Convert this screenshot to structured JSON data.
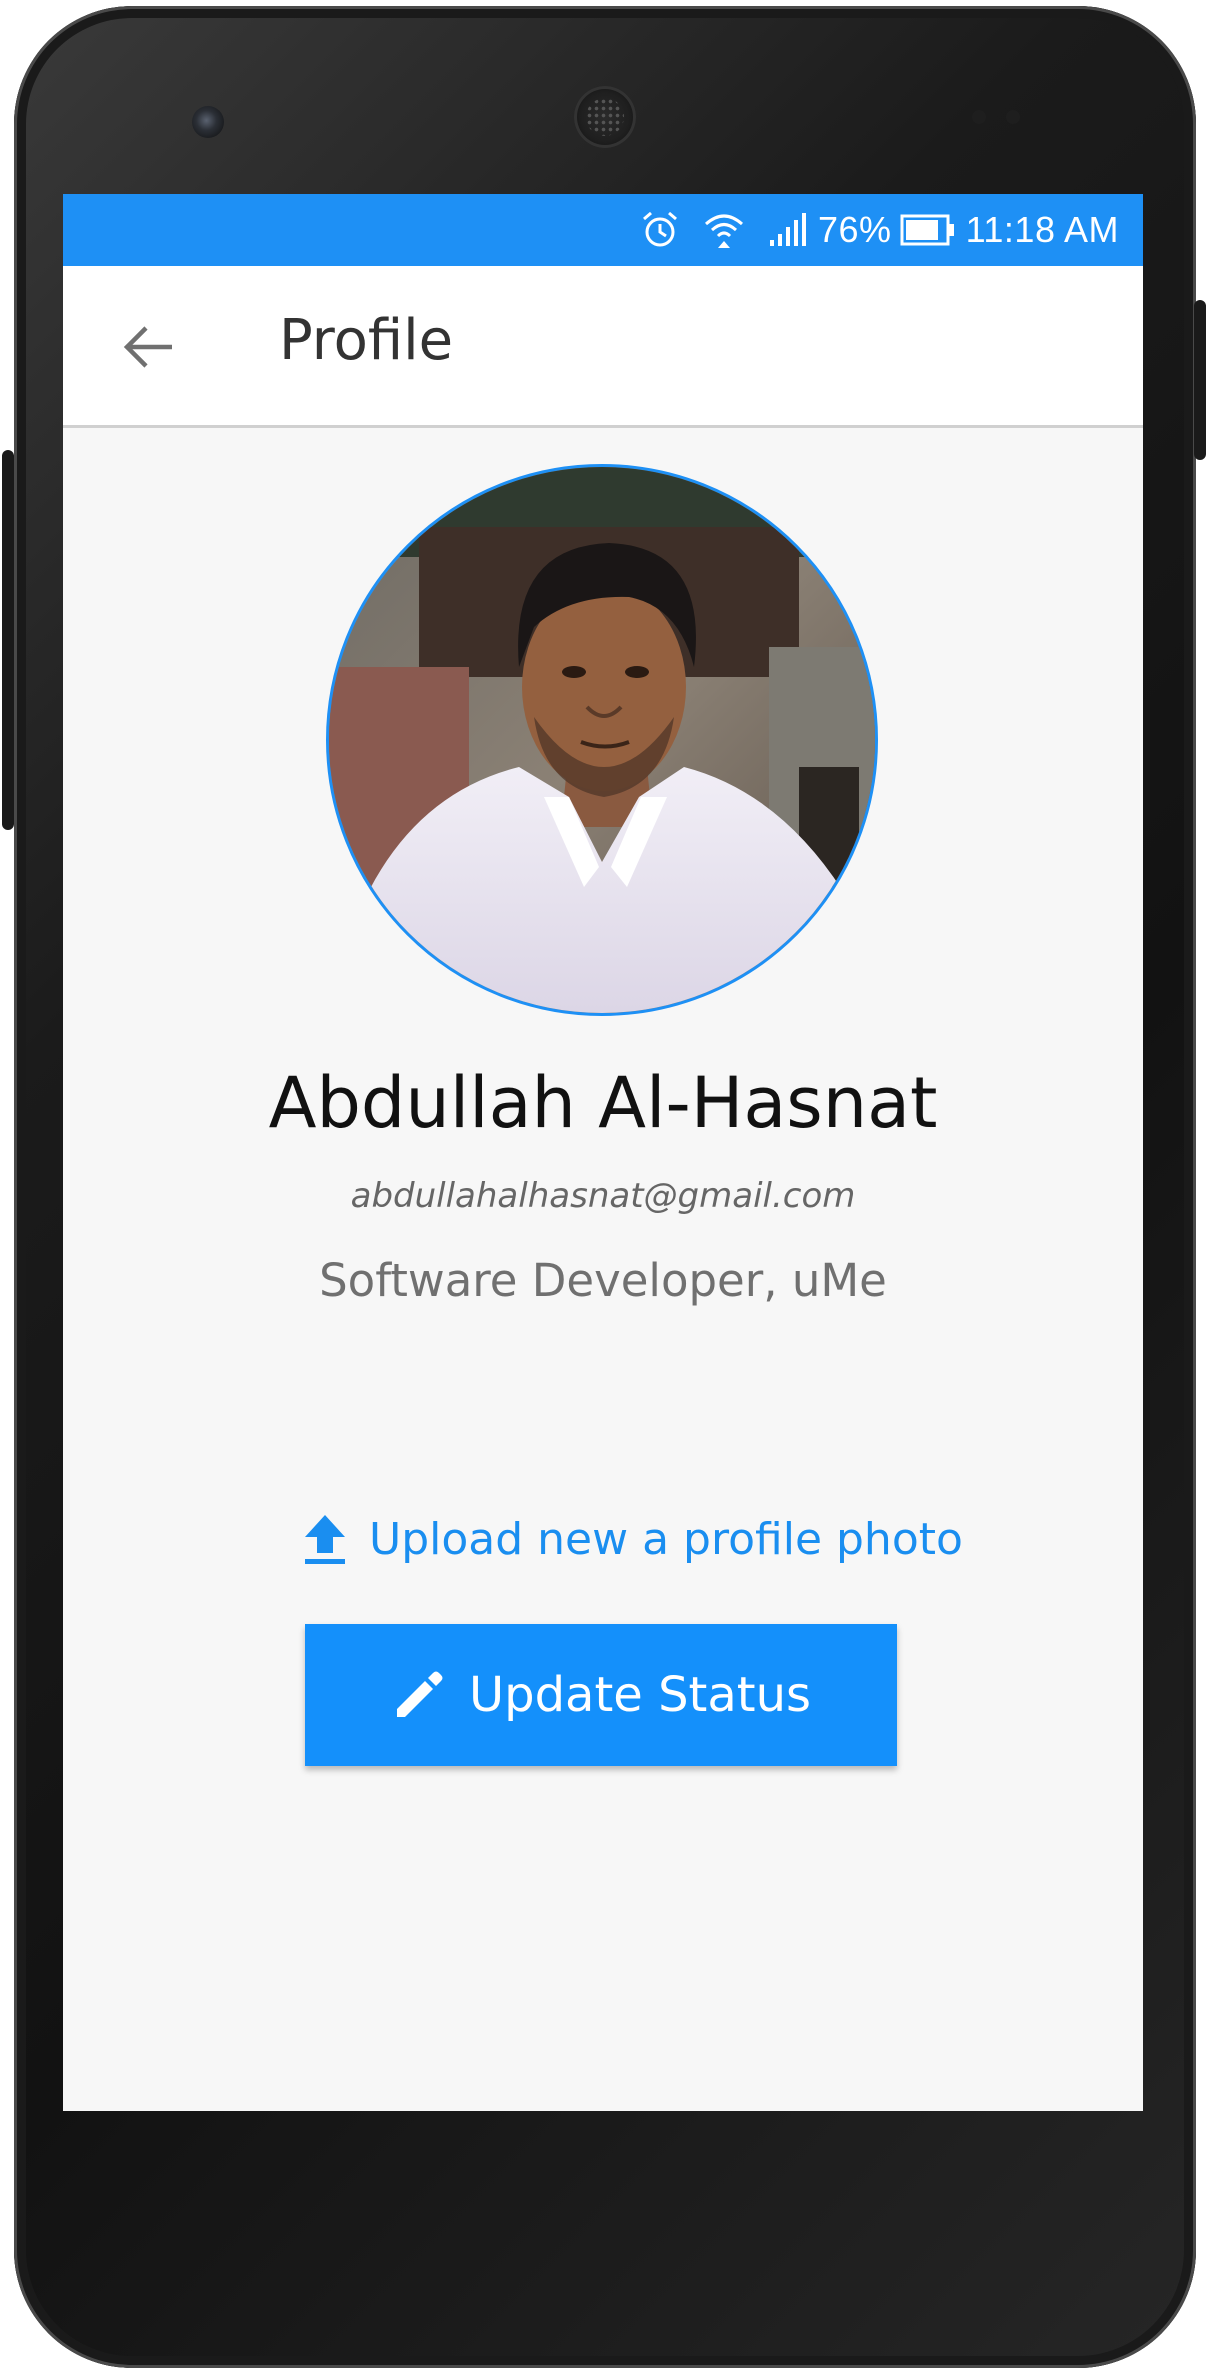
{
  "status_bar": {
    "battery_percent": "76%",
    "time": "11:18 AM",
    "icons": [
      "alarm-icon",
      "wifi-icon",
      "signal-icon",
      "battery-icon"
    ],
    "color": "#1e90f5"
  },
  "app_bar": {
    "title": "Profile",
    "back_icon": "arrow-left-icon"
  },
  "profile": {
    "name": "Abdullah Al-Hasnat",
    "email": "abdullahalhasnat@gmail.com",
    "job": "Software Developer, uMe",
    "avatar_ring_color": "#1e90f5"
  },
  "actions": {
    "upload_label": "Upload new a profile photo",
    "upload_icon": "upload-icon",
    "update_status_label": "Update Status",
    "update_status_icon": "pencil-icon",
    "accent": "#1490fb"
  }
}
